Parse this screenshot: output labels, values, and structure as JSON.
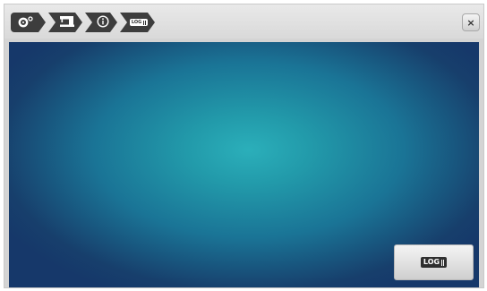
{
  "header": {
    "breadcrumbs": [
      {
        "icon": "settings-gear-icon"
      },
      {
        "icon": "sewing-machine-icon"
      },
      {
        "icon": "info-icon"
      },
      {
        "icon": "log-icon",
        "label": "LOG"
      }
    ],
    "close_label": "×"
  },
  "main": {
    "log_button_label": "LOG"
  },
  "colors": {
    "screen_center": "#2bafba",
    "screen_edge": "#16386a",
    "breadcrumb_bg": "#3d3d3d",
    "chrome_bg": "#d4d4d4"
  }
}
